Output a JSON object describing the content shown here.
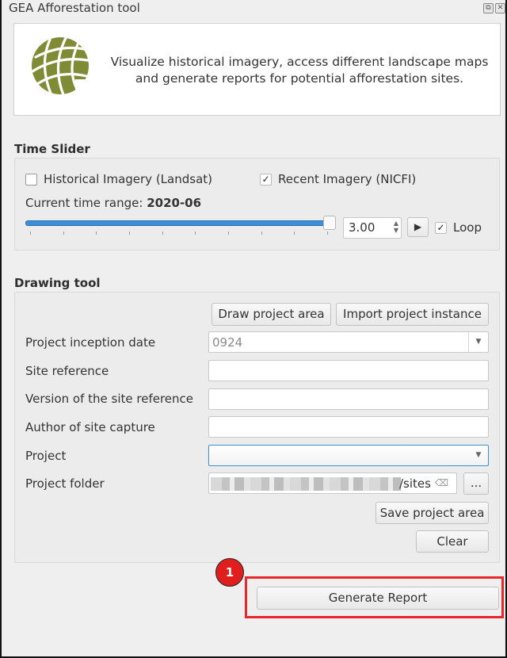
{
  "window": {
    "title": "GEA Afforestation tool",
    "float_icon": "⧉",
    "close_icon": "✕"
  },
  "banner": {
    "logo": "globe-logo-icon",
    "line1": "Visualize historical imagery, access different landscape maps",
    "line2": "and generate reports for potential afforestation sites.",
    "logo_color": "#7f8c35"
  },
  "time_slider": {
    "title": "Time Slider",
    "historical_label": "Historical Imagery (Landsat)",
    "historical_checked": false,
    "recent_label": "Recent Imagery (NICFI)",
    "recent_checked": true,
    "range_label": "Current time range: ",
    "range_value": "2020-06",
    "slider_position_fraction": 1.0,
    "tick_count": 10,
    "speed_value": "3.00",
    "play_icon": "▶",
    "loop_label": "Loop",
    "loop_checked": true,
    "accent_color": "#3b8fd9"
  },
  "drawing_tool": {
    "title": "Drawing tool",
    "draw_button": "Draw project area",
    "import_button": "Import project instance",
    "fields": {
      "inception_date": {
        "label": "Project inception date",
        "value": "0924"
      },
      "site_reference": {
        "label": "Site reference",
        "value": ""
      },
      "site_reference_version": {
        "label": "Version of the site reference",
        "value": ""
      },
      "author": {
        "label": "Author of site capture",
        "value": ""
      },
      "project": {
        "label": "Project",
        "value": ""
      },
      "project_folder": {
        "label": "Project folder",
        "value_visible_suffix": "/sites",
        "browse_label": "..."
      }
    },
    "save_button": "Save project area",
    "clear_button": "Clear"
  },
  "generate_button": "Generate Report",
  "annotation": {
    "badge_number": "1",
    "highlight_color": "#e8272b"
  }
}
